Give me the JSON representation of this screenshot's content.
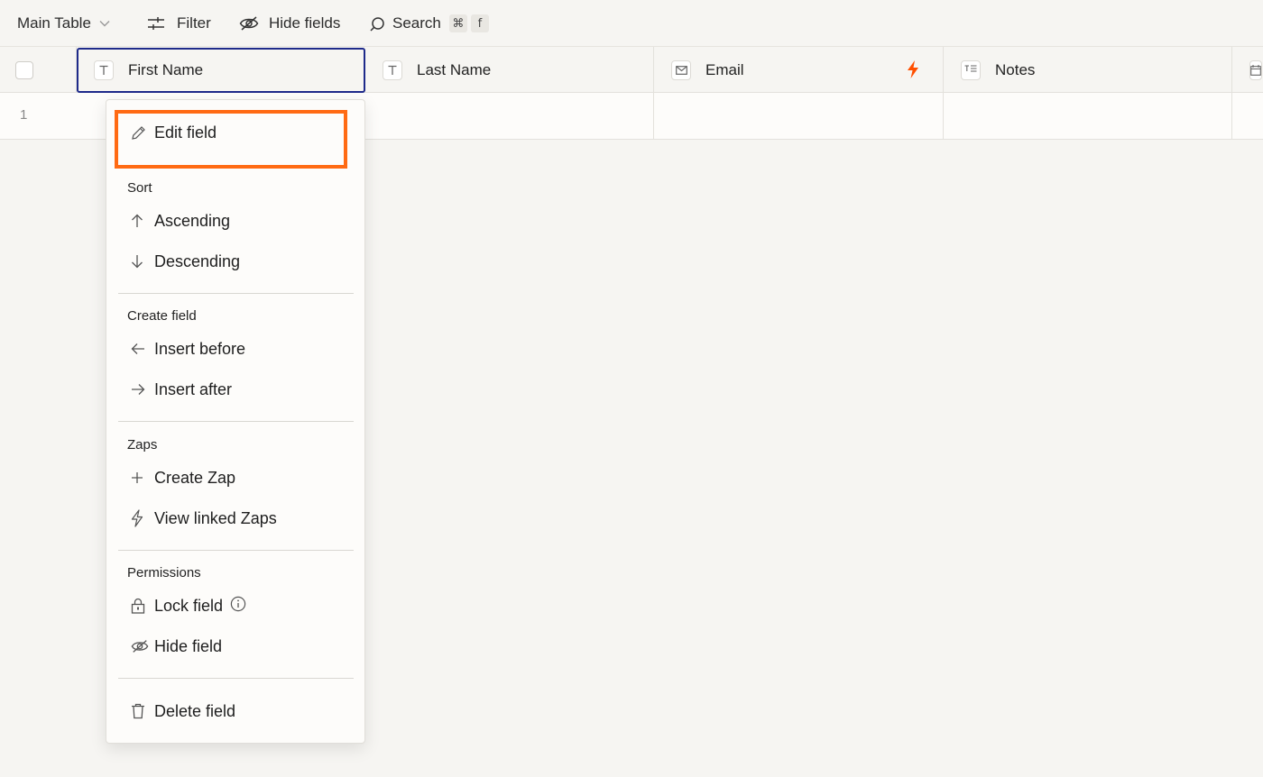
{
  "toolbar": {
    "table_label": "Main Table",
    "filter_label": "Filter",
    "hide_fields_label": "Hide fields",
    "search_label": "Search",
    "search_shortcut_mod": "⌘",
    "search_shortcut_key": "f"
  },
  "columns": {
    "first_name": "First Name",
    "last_name": "Last Name",
    "email": "Email",
    "notes": "Notes"
  },
  "rows": [
    {
      "number": "1"
    }
  ],
  "menu": {
    "edit_field": "Edit field",
    "sort_header": "Sort",
    "ascending": "Ascending",
    "descending": "Descending",
    "create_field_header": "Create field",
    "insert_before": "Insert before",
    "insert_after": "Insert after",
    "zaps_header": "Zaps",
    "create_zap": "Create Zap",
    "view_linked_zaps": "View linked Zaps",
    "permissions_header": "Permissions",
    "lock_field": "Lock field",
    "hide_field": "Hide field",
    "delete_field": "Delete field"
  },
  "colors": {
    "accent_highlight": "#ff6a13",
    "selected_column_border": "#1e2a8a",
    "bolt": "#ff4f00"
  }
}
